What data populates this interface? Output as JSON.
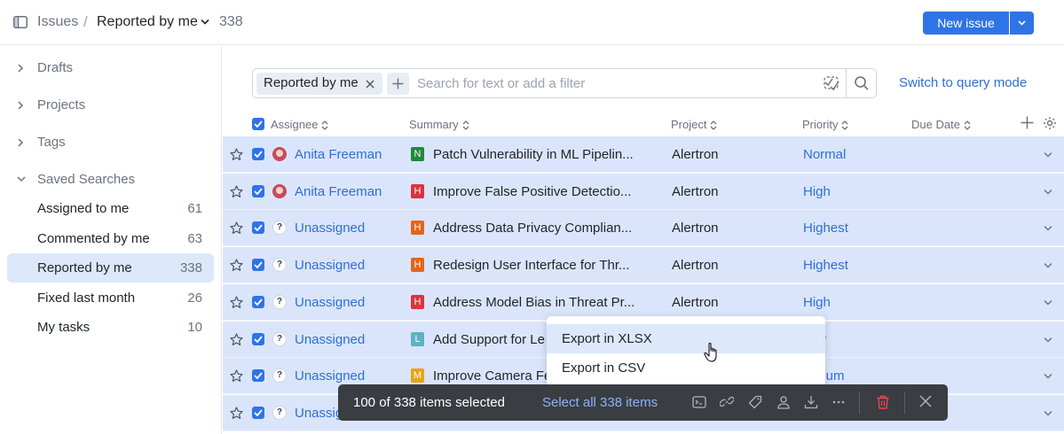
{
  "header": {
    "section": "Issues",
    "separator": "/",
    "title": "Reported by me",
    "count": "338",
    "new_issue_label": "New issue"
  },
  "sidebar": {
    "sections": [
      {
        "label": "Drafts"
      },
      {
        "label": "Projects"
      },
      {
        "label": "Tags"
      },
      {
        "label": "Saved Searches"
      }
    ],
    "saved_searches": [
      {
        "label": "Assigned to me",
        "count": "61"
      },
      {
        "label": "Commented by me",
        "count": "63"
      },
      {
        "label": "Reported by me",
        "count": "338",
        "active": true
      },
      {
        "label": "Fixed last month",
        "count": "26"
      },
      {
        "label": "My tasks",
        "count": "10"
      }
    ]
  },
  "search": {
    "chip_label": "Reported by me",
    "placeholder": "Search for text or add a filter",
    "switch_label": "Switch to query mode"
  },
  "table": {
    "columns": [
      "Assignee",
      "Summary",
      "Project",
      "Priority",
      "Due Date"
    ],
    "rows": [
      {
        "assignee": "Anita Freeman",
        "avatar": "photo",
        "badge": "N",
        "badge_color": "#1f8a3b",
        "summary": "Patch Vulnerability in ML Pipelin...",
        "project": "Alertron",
        "priority": "Normal"
      },
      {
        "assignee": "Anita Freeman",
        "avatar": "photo",
        "badge": "H",
        "badge_color": "#d9343f",
        "summary": "Improve False Positive Detectio...",
        "project": "Alertron",
        "priority": "High"
      },
      {
        "assignee": "Unassigned",
        "avatar": "?",
        "badge": "H",
        "badge_color": "#e3641c",
        "summary": "Address Data Privacy Complian...",
        "project": "Alertron",
        "priority": "Highest"
      },
      {
        "assignee": "Unassigned",
        "avatar": "?",
        "badge": "H",
        "badge_color": "#e3641c",
        "summary": "Redesign User Interface for Thr...",
        "project": "Alertron",
        "priority": "Highest"
      },
      {
        "assignee": "Unassigned",
        "avatar": "?",
        "badge": "H",
        "badge_color": "#d9343f",
        "summary": "Address Model Bias in Threat Pr...",
        "project": "Alertron",
        "priority": "High"
      },
      {
        "assignee": "Unassigned",
        "avatar": "?",
        "badge": "L",
        "badge_color": "#5bb3c1",
        "summary": "Add Support for Le",
        "project": "",
        "priority": "w"
      },
      {
        "assignee": "Unassigned",
        "avatar": "?",
        "badge": "M",
        "badge_color": "#e8a317",
        "summary": "Improve Camera Fe",
        "project": "",
        "priority": "dium"
      },
      {
        "assignee": "Unassig",
        "avatar": "?",
        "badge": "",
        "badge_color": "#e8a317",
        "summary": "",
        "project": "",
        "priority": ""
      }
    ]
  },
  "export_menu": {
    "items": [
      "Export in XLSX",
      "Export in CSV"
    ]
  },
  "action_bar": {
    "selected_text": "100 of 338 items selected",
    "select_all_label": "Select all 338 items"
  },
  "icons": {
    "panel": "sidebar-panel-icon",
    "star": "star-icon",
    "checkbox": "checkbox-icon",
    "delete": "trash-icon",
    "close": "close-icon"
  },
  "colors": {
    "accent": "#2f74e6",
    "link": "#2f6fd6",
    "selected_row": "#dae5fb",
    "action_bar": "#3a3d42",
    "delete": "#e5484d"
  }
}
